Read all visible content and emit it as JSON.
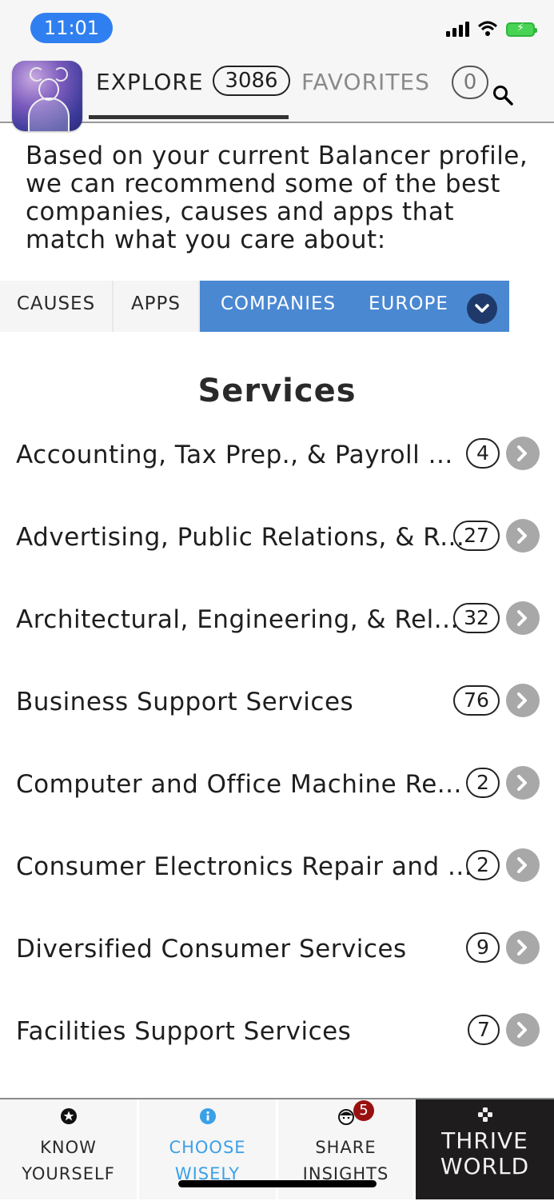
{
  "status": {
    "time": "11:01"
  },
  "header": {
    "explore_label": "EXPLORE",
    "explore_count": "3086",
    "favorites_label": "FAVORITES",
    "favorites_count": "0"
  },
  "intro": "Based on your current Balancer profile, we can recommend some of the best companies, causes and apps that match what you care about:",
  "filters": {
    "causes": "CAUSES",
    "apps": "APPS",
    "companies": "COMPANIES",
    "region": "EUROPE"
  },
  "section_title": "Services",
  "items": [
    {
      "label": "Accounting, Tax Prep., & Payroll ...",
      "count": "4"
    },
    {
      "label": "Advertising, Public Relations, & R...",
      "count": "27"
    },
    {
      "label": "Architectural, Engineering, & Rel...",
      "count": "32"
    },
    {
      "label": "Business Support Services",
      "count": "76"
    },
    {
      "label": "Computer and Office Machine Re...",
      "count": "2"
    },
    {
      "label": "Consumer Electronics Repair and ...",
      "count": "2"
    },
    {
      "label": "Diversified Consumer Services",
      "count": "9"
    },
    {
      "label": "Facilities Support Services",
      "count": "7"
    }
  ],
  "nav": {
    "know_line1": "KNOW",
    "know_line2": "YOURSELF",
    "choose_line1": "CHOOSE",
    "choose_line2": "WISELY",
    "share_line1": "SHARE",
    "share_line2": "INSIGHTS",
    "share_badge": "5",
    "thrive_line1": "THRIVE",
    "thrive_line2": "WORLD"
  },
  "colors": {
    "accent_blue": "#4a88d2",
    "choose_blue": "#3aa0e8",
    "badge_red": "#9a1010",
    "time_pill": "#2f7ff0"
  },
  "icons": [
    "search-icon",
    "chevron-down-icon",
    "chevron-right-icon",
    "star-icon",
    "info-icon",
    "face-icon",
    "puzzle-icon"
  ]
}
